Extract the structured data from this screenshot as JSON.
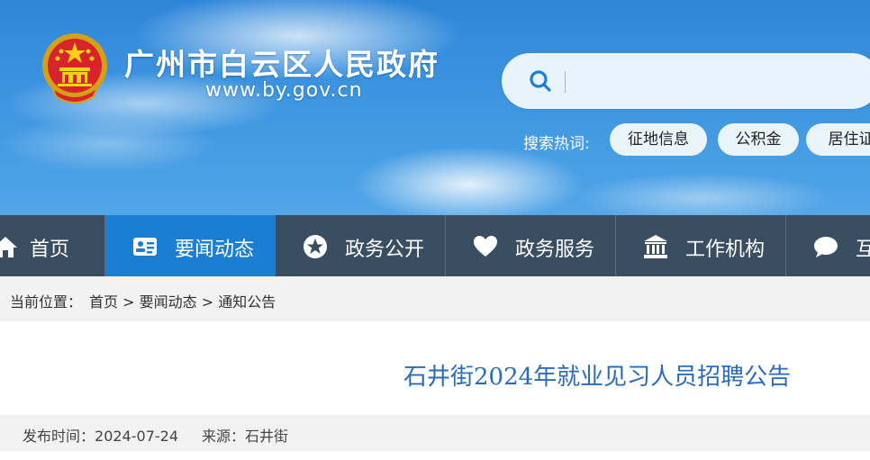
{
  "header": {
    "site_title": "广州市白云区人民政府",
    "site_url": "www.by.gov.cn",
    "search": {
      "placeholder": ""
    },
    "hot_label": "搜索热词:",
    "hot_tags": [
      "征地信息",
      "公积金",
      "居住证"
    ]
  },
  "nav": {
    "items": [
      {
        "label": "首页",
        "icon": "home-icon",
        "active": false
      },
      {
        "label": "要闻动态",
        "icon": "news-card-icon",
        "active": true
      },
      {
        "label": "政务公开",
        "icon": "star-icon",
        "active": false
      },
      {
        "label": "政务服务",
        "icon": "heart-icon",
        "active": false
      },
      {
        "label": "工作机构",
        "icon": "building-icon",
        "active": false
      },
      {
        "label": "互",
        "icon": "chat-bubble-icon",
        "active": false
      }
    ]
  },
  "breadcrumb": {
    "prefix": "当前位置：",
    "items": [
      "首页",
      "要闻动态",
      "通知公告"
    ],
    "separator": " > "
  },
  "article": {
    "title": "石井街2024年就业见习人员招聘公告",
    "date_label": "发布时间：",
    "date": "2024-07-24",
    "source_label": "来源：",
    "source": "石井街"
  },
  "colors": {
    "nav_bg": "#3a4e61",
    "nav_active": "#1a7fd3",
    "title_blue": "#2b6cb8",
    "sky": "#3d95e0"
  }
}
